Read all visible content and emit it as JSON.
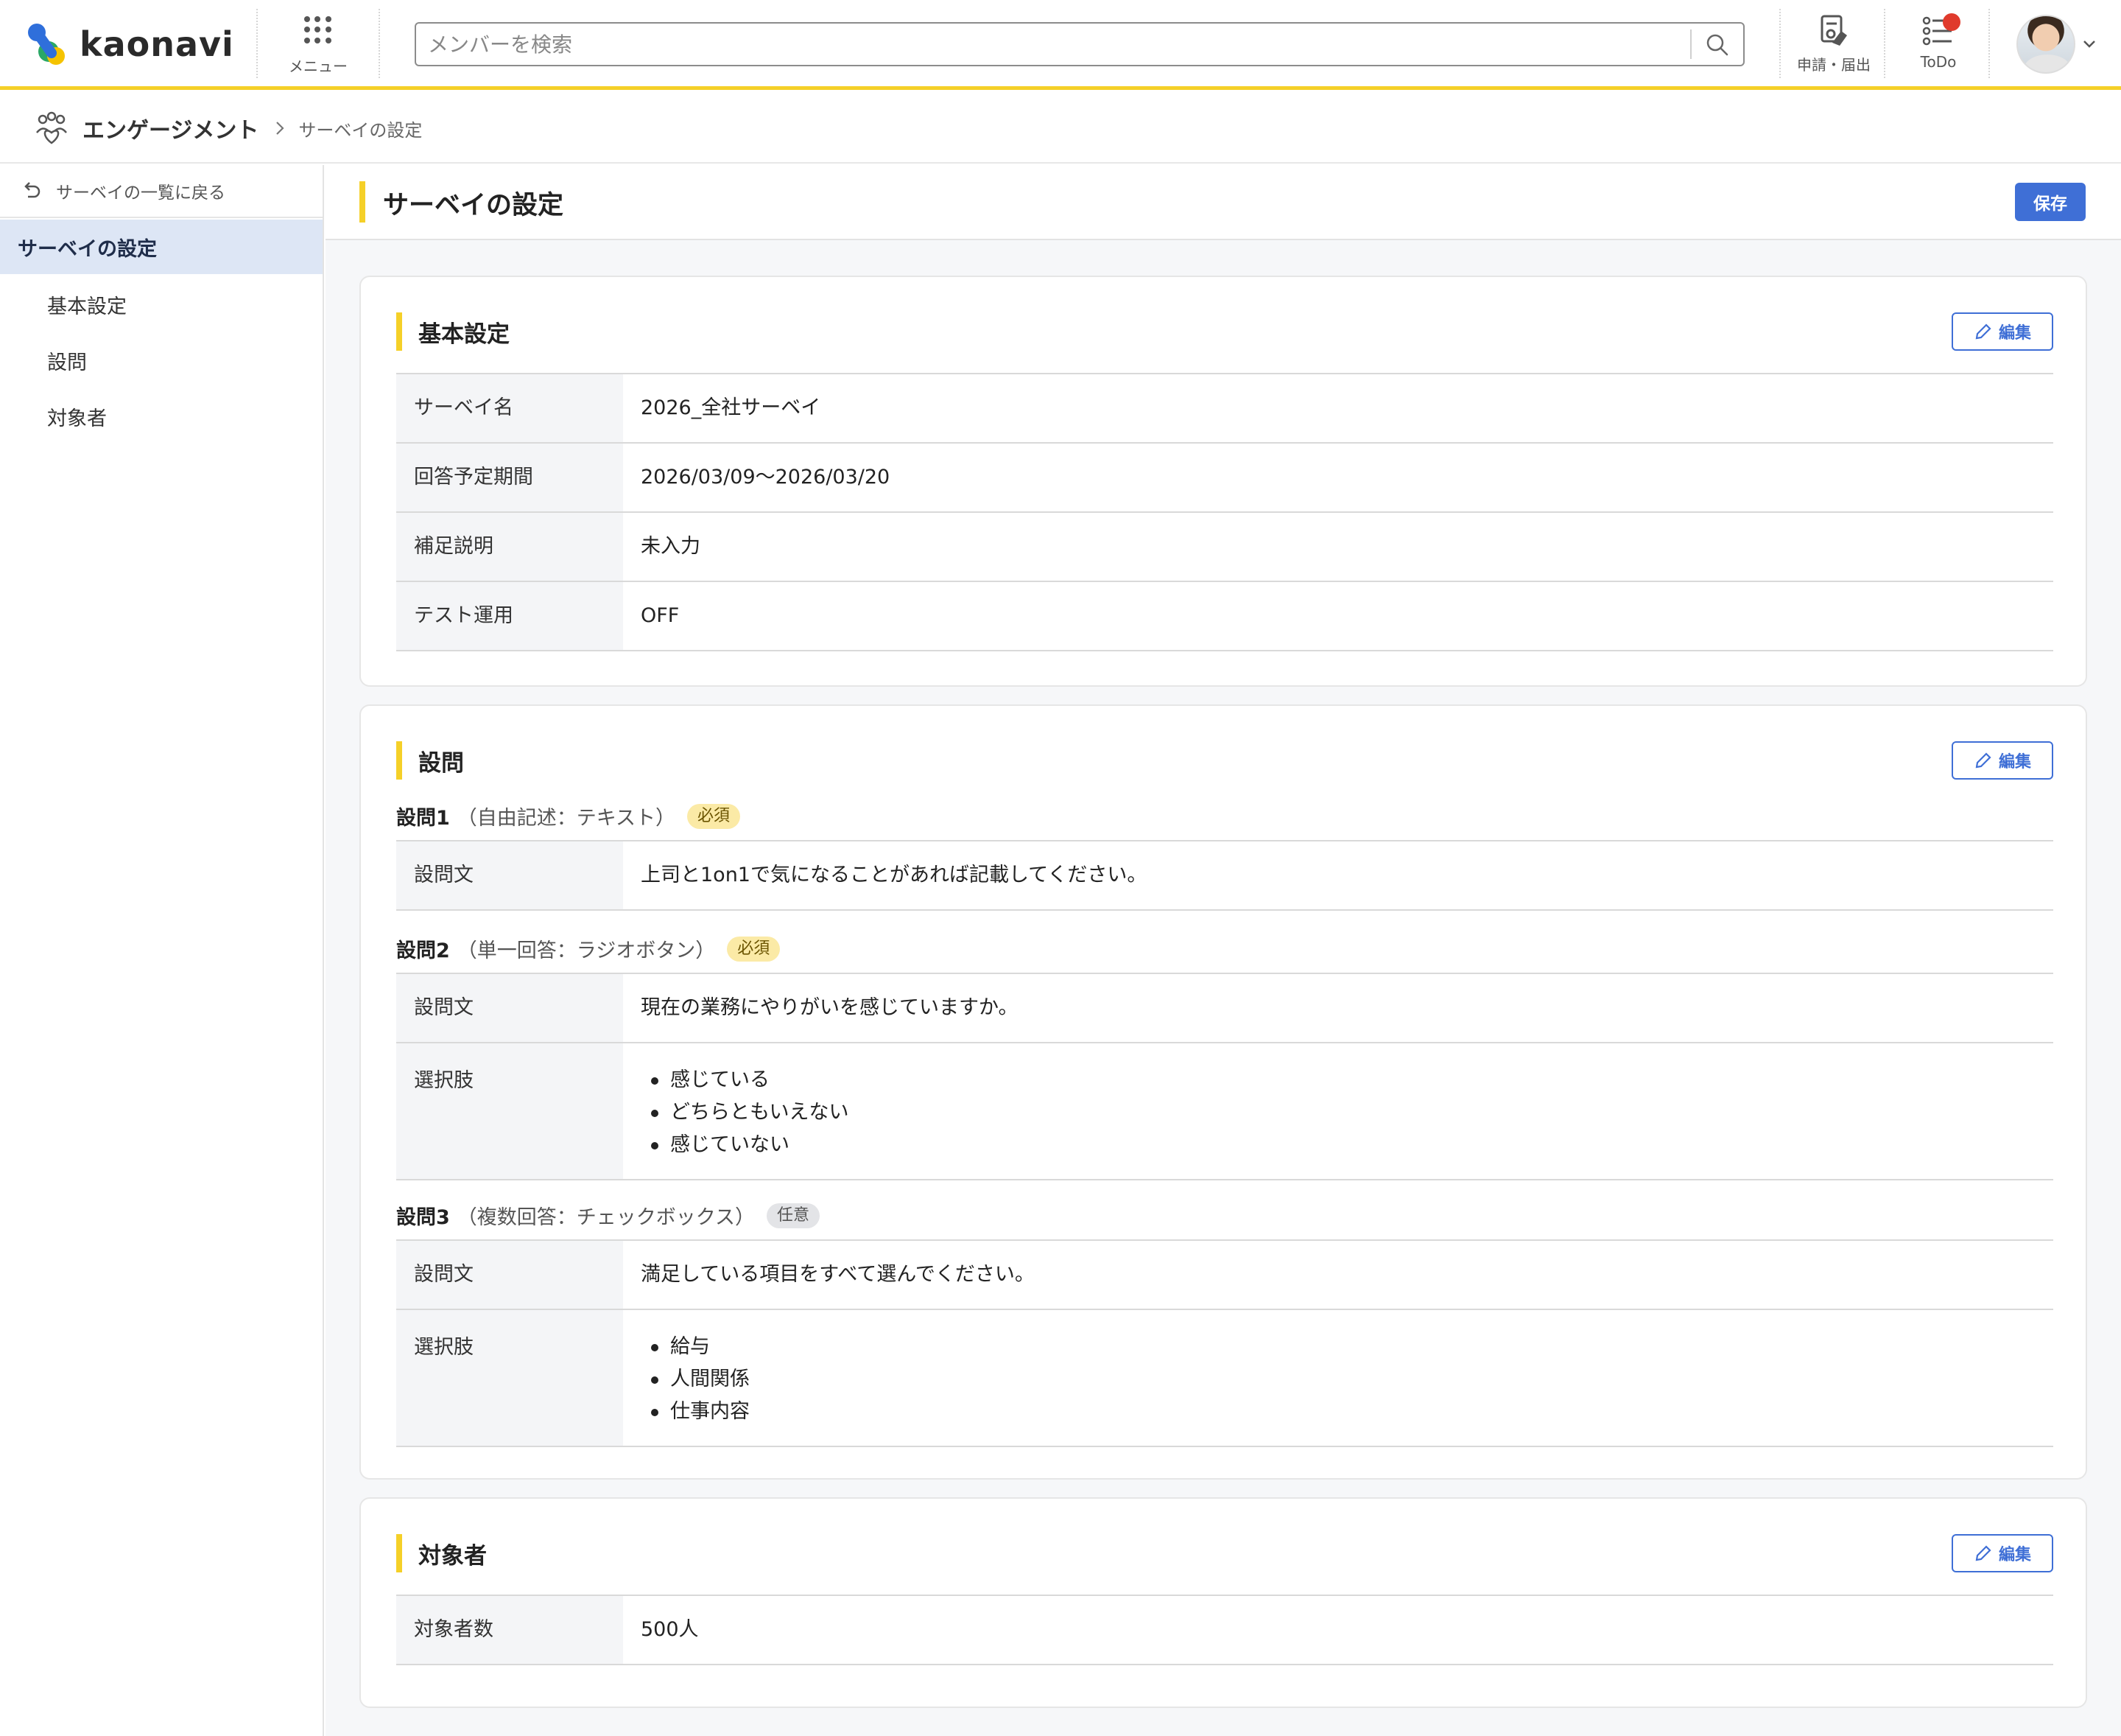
{
  "header": {
    "logo_text": "kaonavi",
    "menu_label": "メニュー",
    "search_placeholder": "メンバーを検索",
    "apply_label": "申請・届出",
    "todo_label": "ToDo",
    "todo_badge_color": "#e03a2c",
    "accent_color": "#f5d028"
  },
  "breadcrumb": {
    "main": "エンゲージメント",
    "current": "サーベイの設定"
  },
  "sidebar": {
    "back_label": "サーベイの一覧に戻る",
    "active_label": "サーベイの設定",
    "items": [
      {
        "label": "基本設定"
      },
      {
        "label": "設問"
      },
      {
        "label": "対象者"
      }
    ]
  },
  "page": {
    "title": "サーベイの設定",
    "save_label": "保存",
    "primary_color": "#3f6fd6"
  },
  "basic": {
    "title": "基本設定",
    "edit_label": "編集",
    "rows": [
      {
        "key": "サーベイ名",
        "value": "2026_全社サーベイ"
      },
      {
        "key": "回答予定期間",
        "value": "2026/03/09〜2026/03/20"
      },
      {
        "key": "補足説明",
        "value": "未入力"
      },
      {
        "key": "テスト運用",
        "value": "OFF"
      }
    ]
  },
  "questions": {
    "title": "設問",
    "edit_label": "編集",
    "items": [
      {
        "name": "設問1",
        "type": "（自由記述：テキスト）",
        "badge": "必須",
        "text_key": "設問文",
        "text": "上司と1on1で気になることがあれば記載してください。"
      },
      {
        "name": "設問2",
        "type": "（単一回答：ラジオボタン）",
        "badge": "必須",
        "text_key": "設問文",
        "text": "現在の業務にやりがいを感じていますか。",
        "options_key": "選択肢",
        "options": [
          "感じている",
          "どちらともいえない",
          "感じていない"
        ]
      },
      {
        "name": "設問3",
        "type": "（複数回答：チェックボックス）",
        "badge": "任意",
        "text_key": "設問文",
        "text": "満足している項目をすべて選んでください。",
        "options_key": "選択肢",
        "options": [
          "給与",
          "人間関係",
          "仕事内容"
        ]
      }
    ]
  },
  "target": {
    "title": "対象者",
    "edit_label": "編集",
    "rows": [
      {
        "key": "対象者数",
        "value": "500人"
      }
    ]
  }
}
